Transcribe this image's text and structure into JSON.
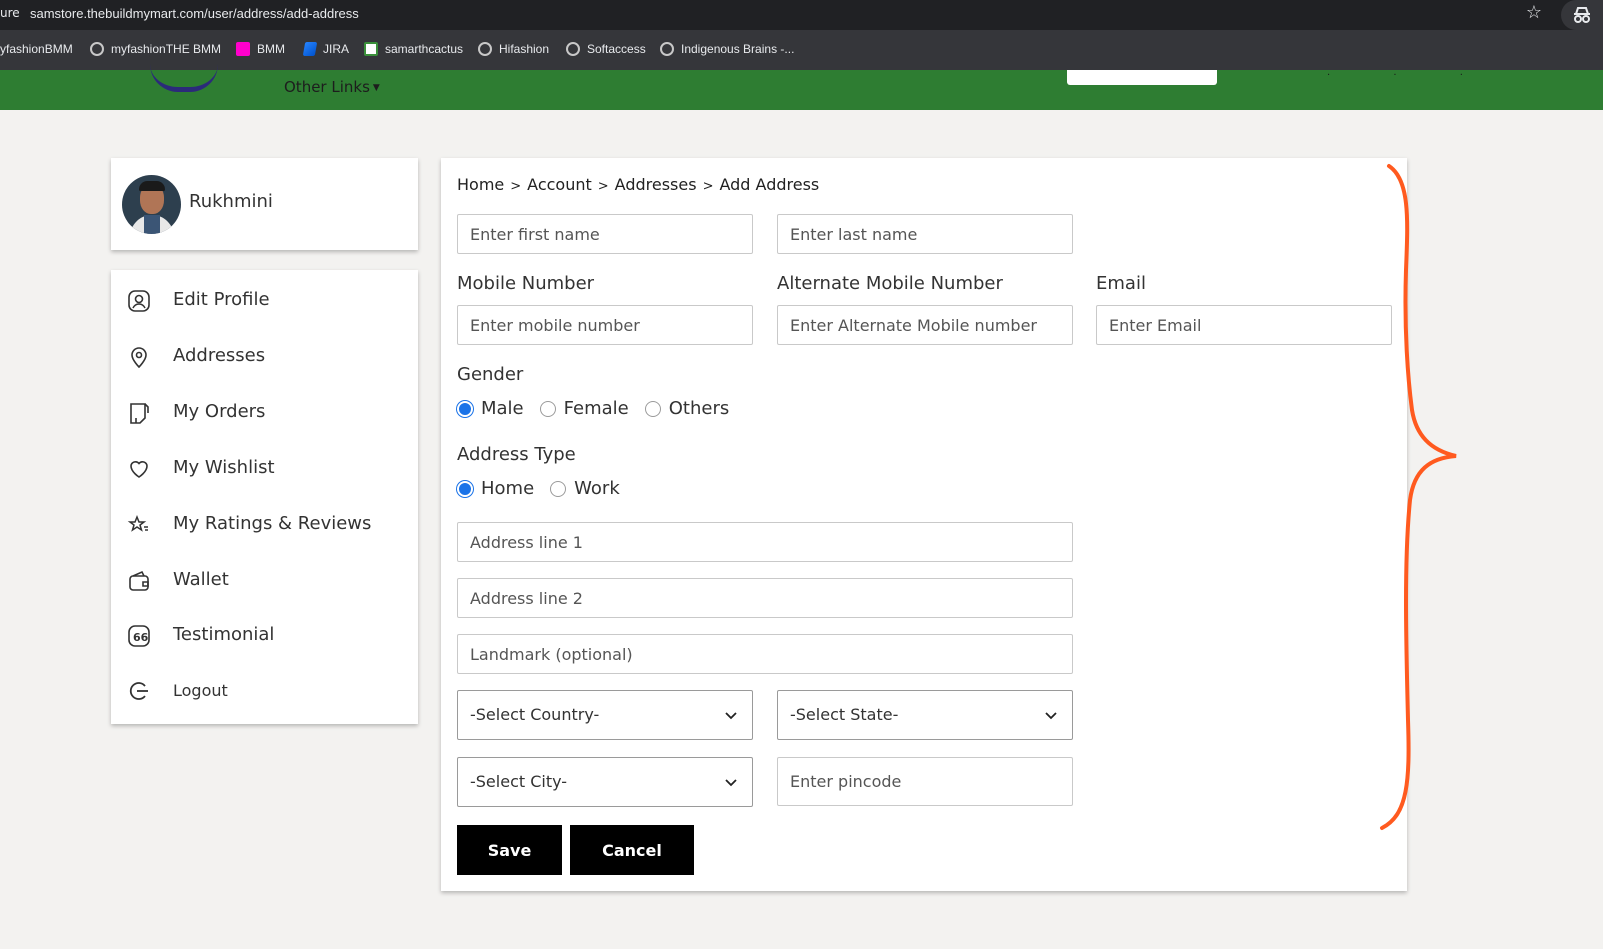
{
  "browser": {
    "scheme": "ure",
    "url": "samstore.thebuildmymart.com/user/address/add-address",
    "bookmarks": [
      {
        "label": "yfashionBMM"
      },
      {
        "label": "myfashionTHE BMM"
      },
      {
        "label": "BMM"
      },
      {
        "label": "JIRA"
      },
      {
        "label": "samarthcactus"
      },
      {
        "label": "Hifashion"
      },
      {
        "label": "Softaccess"
      },
      {
        "label": "Indigenous Brains -..."
      }
    ]
  },
  "site_header": {
    "other_links": "Other Links",
    "color": "#2e7d32"
  },
  "profile": {
    "name": "Rukhmini"
  },
  "sidebar": {
    "items": [
      {
        "label": "Edit Profile",
        "icon": "user-circle-icon"
      },
      {
        "label": "Addresses",
        "icon": "map-pin-icon"
      },
      {
        "label": "My Orders",
        "icon": "orders-icon"
      },
      {
        "label": "My Wishlist",
        "icon": "heart-icon"
      },
      {
        "label": "My Ratings & Reviews",
        "icon": "star-icon"
      },
      {
        "label": "Wallet",
        "icon": "wallet-icon"
      },
      {
        "label": "Testimonial",
        "icon": "quote-icon"
      },
      {
        "label": "Logout",
        "icon": "logout-icon"
      }
    ]
  },
  "breadcrumb": [
    "Home",
    "Account",
    "Addresses",
    "Add Address"
  ],
  "form": {
    "first_name": {
      "placeholder": "Enter first name",
      "value": ""
    },
    "last_name": {
      "placeholder": "Enter last name",
      "value": ""
    },
    "mobile": {
      "label": "Mobile Number",
      "placeholder": "Enter mobile number"
    },
    "alt_mobile": {
      "label": "Alternate Mobile Number",
      "placeholder": "Enter Alternate Mobile number"
    },
    "email": {
      "label": "Email",
      "placeholder": "Enter Email"
    },
    "gender": {
      "label": "Gender",
      "options": [
        "Male",
        "Female",
        "Others"
      ],
      "selected": "Male"
    },
    "address_type": {
      "label": "Address Type",
      "options": [
        "Home",
        "Work"
      ],
      "selected": "Home"
    },
    "address_line1": {
      "placeholder": "Address line 1"
    },
    "address_line2": {
      "placeholder": "Address line 2"
    },
    "landmark": {
      "placeholder": "Landmark (optional)"
    },
    "country": {
      "value": "-Select Country-"
    },
    "state": {
      "value": "-Select State-"
    },
    "city": {
      "value": "-Select City-"
    },
    "pincode": {
      "placeholder": "Enter pincode"
    },
    "save_label": "Save",
    "cancel_label": "Cancel"
  },
  "colors": {
    "accent": "#1a73e8",
    "annotation": "#ff5a1f",
    "button": "#000000"
  }
}
